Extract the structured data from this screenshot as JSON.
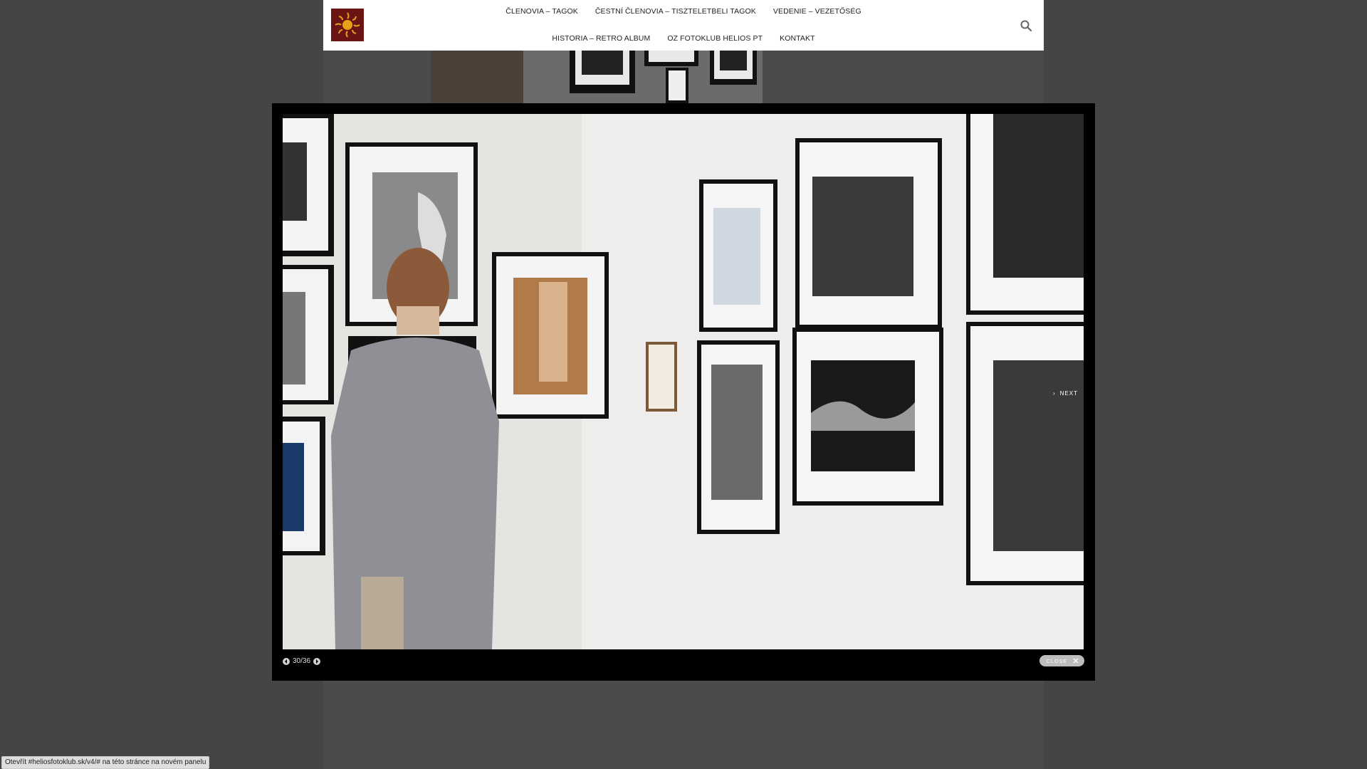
{
  "header": {
    "nav_row1": [
      "ČLENOVIA – TAGOK",
      "ČESTNÍ ČLENOVIA – TISZTELETBELI TAGOK",
      "VEDENIE – VEZETŐSÉG"
    ],
    "nav_row2": [
      "HISTORIA – RETRO ALBUM",
      "OZ FOTOKLUB HELIOS PT",
      "KONTAKT"
    ]
  },
  "lightbox": {
    "counter": "30/36",
    "next_label": "NEXT",
    "close_label": "CLOSE"
  },
  "status_bar": {
    "text": "Otevřít #heliosfotoklub.sk/v4/# na této stránce na novém panelu"
  },
  "colors": {
    "overlay": "#454545",
    "logo_bg": "#6a1414",
    "logo_sun": "#e8a21a"
  }
}
